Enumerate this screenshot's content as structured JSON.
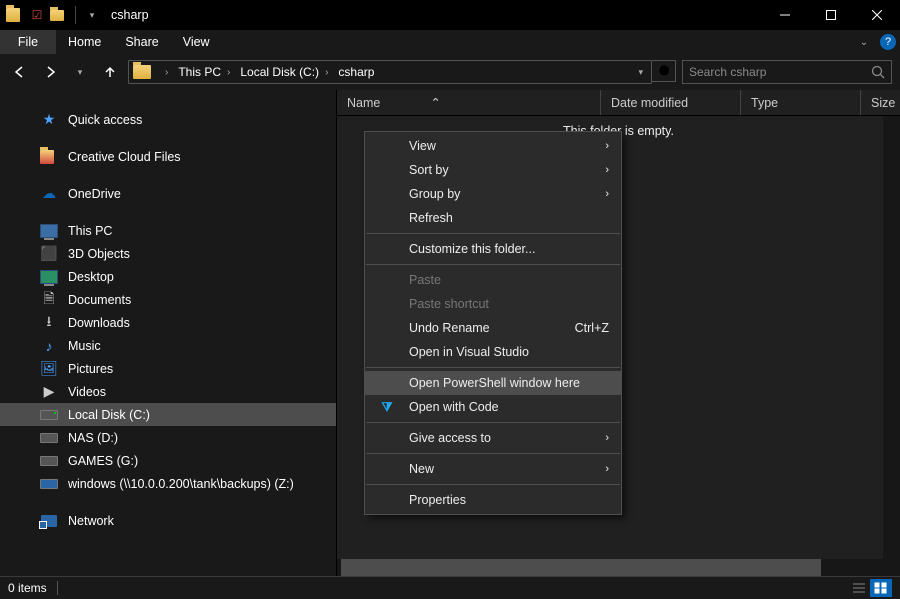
{
  "window": {
    "title": "csharp"
  },
  "ribbon": {
    "file": "File",
    "tabs": [
      "Home",
      "Share",
      "View"
    ]
  },
  "breadcrumbs": [
    "This PC",
    "Local Disk (C:)",
    "csharp"
  ],
  "search": {
    "placeholder": "Search csharp"
  },
  "columns": {
    "name": "Name",
    "date": "Date modified",
    "type": "Type",
    "size": "Size"
  },
  "content": {
    "empty": "This folder is empty."
  },
  "nav": {
    "quick": "Quick access",
    "ccf": "Creative Cloud Files",
    "onedrive": "OneDrive",
    "thispc": "This PC",
    "children": {
      "objects3d": "3D Objects",
      "desktop": "Desktop",
      "documents": "Documents",
      "downloads": "Downloads",
      "music": "Music",
      "pictures": "Pictures",
      "videos": "Videos",
      "local": "Local Disk (C:)",
      "nas": "NAS (D:)",
      "games": "GAMES (G:)",
      "backups": "windows (\\\\10.0.0.200\\tank\\backups) (Z:)"
    },
    "network": "Network"
  },
  "context": {
    "view": "View",
    "sort": "Sort by",
    "group": "Group by",
    "refresh": "Refresh",
    "customize": "Customize this folder...",
    "paste": "Paste",
    "pasteShortcut": "Paste shortcut",
    "undo": "Undo Rename",
    "undo_short": "Ctrl+Z",
    "openvs": "Open in Visual Studio",
    "openps": "Open PowerShell window here",
    "opencode": "Open with Code",
    "give": "Give access to",
    "new": "New",
    "properties": "Properties"
  },
  "status": {
    "items": "0 items"
  }
}
